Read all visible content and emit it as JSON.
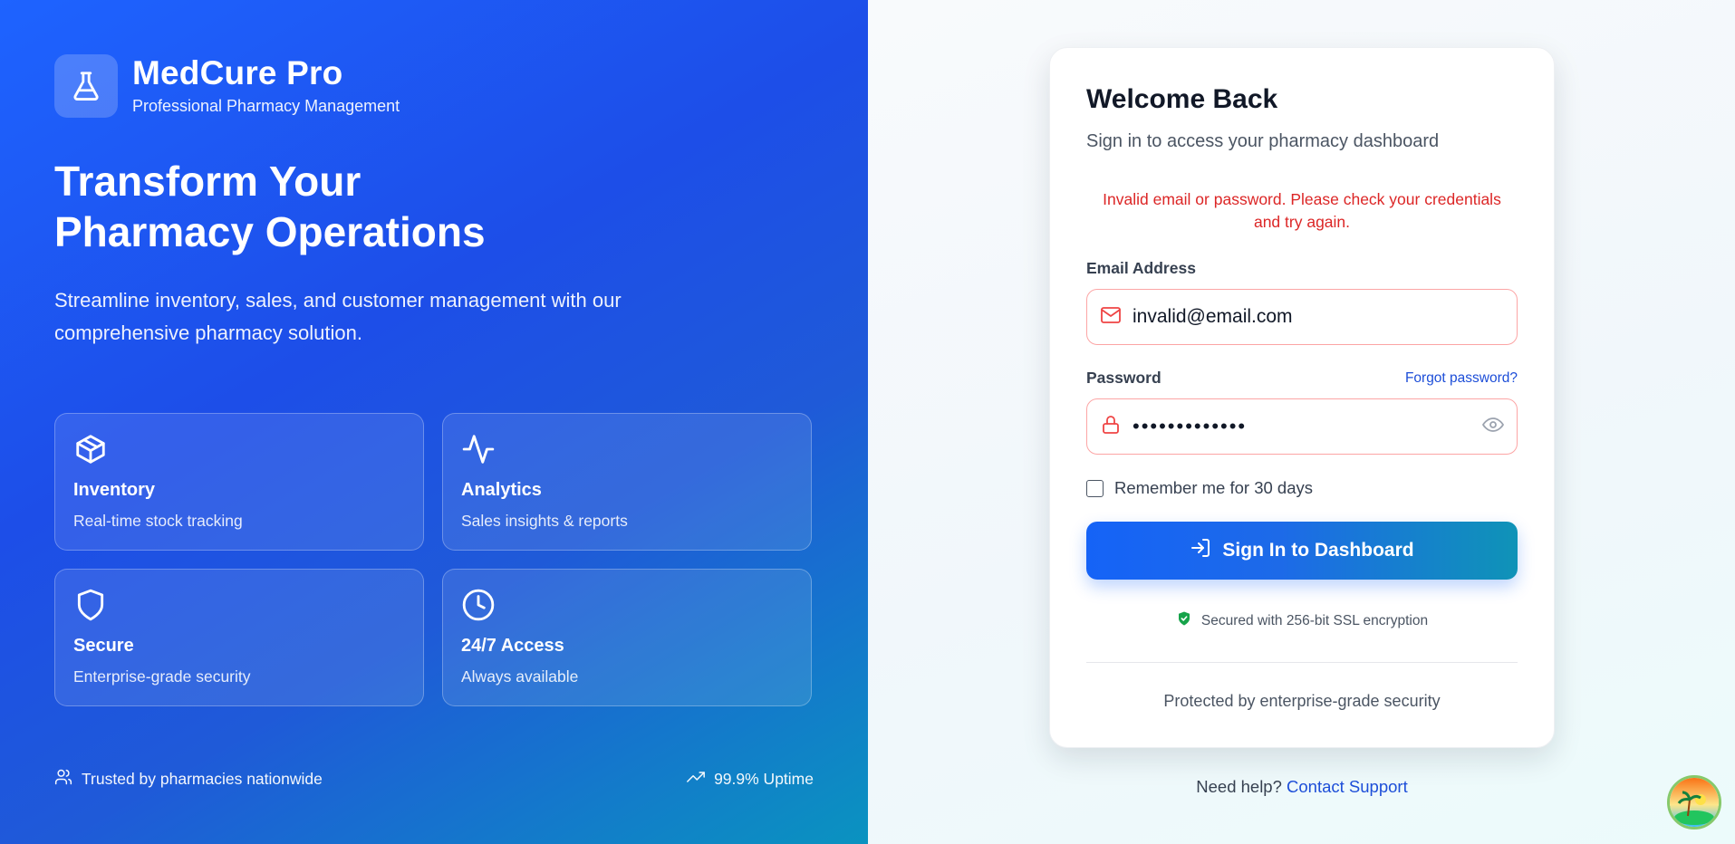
{
  "brand": {
    "name": "MedCure Pro",
    "tagline": "Professional Pharmacy Management",
    "icon": "flask-icon"
  },
  "hero": {
    "headline_line1": "Transform Your",
    "headline_line2": "Pharmacy Operations",
    "lead": "Streamline inventory, sales, and customer management with our comprehensive pharmacy solution."
  },
  "features": [
    {
      "icon": "package-icon",
      "title": "Inventory",
      "desc": "Real-time stock tracking"
    },
    {
      "icon": "activity-icon",
      "title": "Analytics",
      "desc": "Sales insights & reports"
    },
    {
      "icon": "shield-icon",
      "title": "Secure",
      "desc": "Enterprise-grade security"
    },
    {
      "icon": "clock-icon",
      "title": "24/7 Access",
      "desc": "Always available"
    }
  ],
  "hero_footer": {
    "trusted": "Trusted by pharmacies nationwide",
    "uptime": "99.9% Uptime"
  },
  "login": {
    "title": "Welcome Back",
    "subtitle": "Sign in to access your pharmacy dashboard",
    "error": "Invalid email or password. Please check your credentials and try again.",
    "email_label": "Email Address",
    "email_value": "invalid@email.com",
    "password_label": "Password",
    "forgot_link": "Forgot password?",
    "password_value": "•••••••••••••",
    "remember_label": "Remember me for 30 days",
    "remember_checked": false,
    "submit_label": "Sign In to Dashboard",
    "ssl_note": "Secured with 256-bit SSL encryption",
    "protected_note": "Protected by enterprise-grade security"
  },
  "help": {
    "prefix": "Need help?",
    "link": "Contact Support"
  },
  "colors": {
    "primary": "#1563f7",
    "teal": "#0f93b7",
    "error": "#dc2626",
    "success": "#16a34a"
  }
}
